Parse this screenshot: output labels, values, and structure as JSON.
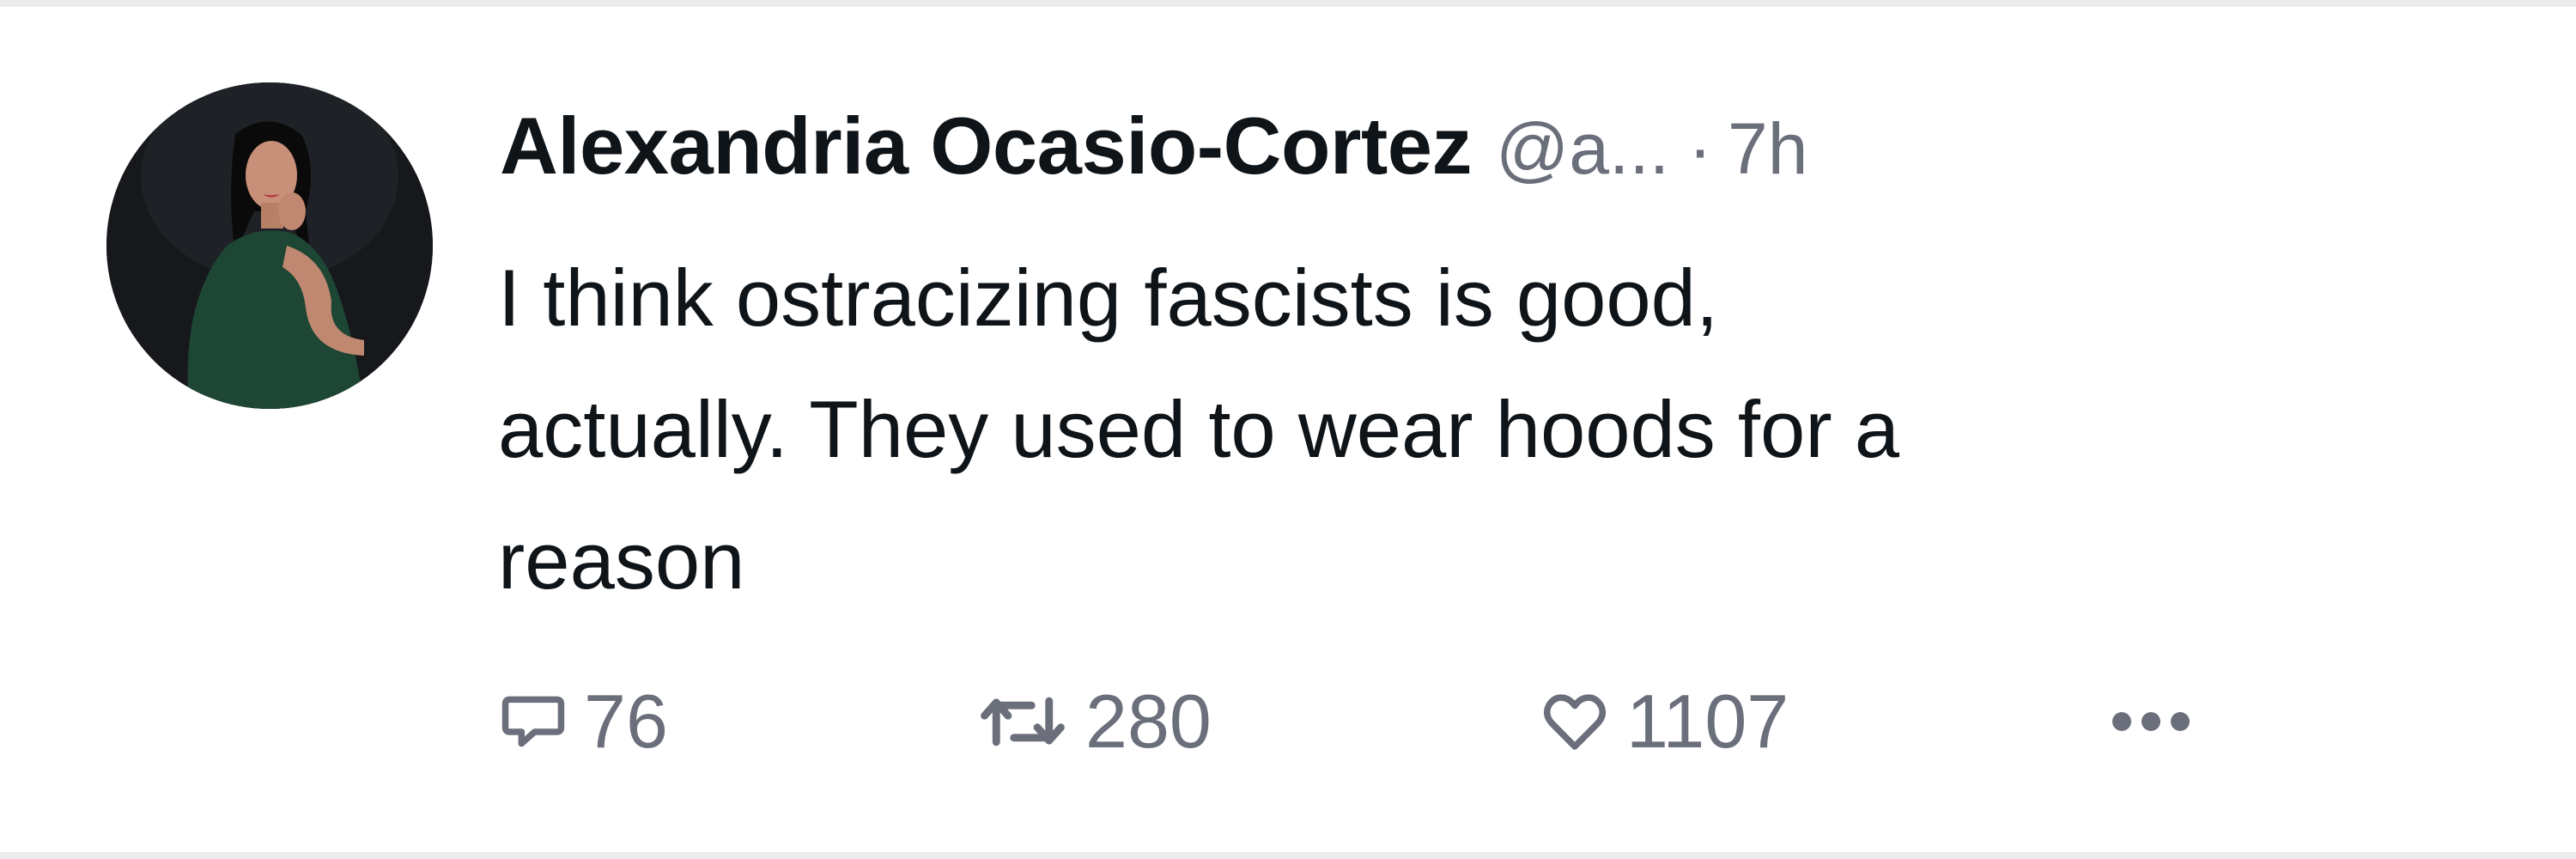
{
  "tweet": {
    "author_name": "Alexandria Ocasio-Cortez",
    "handle": "@a...",
    "separator": "·",
    "time": "7h",
    "text": "I think ostracizing fascists is good,\nactually. They used to wear hoods for a\nreason",
    "avatar_icon": "profile-photo",
    "actions": {
      "reply": {
        "icon": "speech-bubble-icon",
        "count": "76"
      },
      "retweet": {
        "icon": "retweet-arrows-icon",
        "count": "280"
      },
      "like": {
        "icon": "heart-icon",
        "count": "1107"
      },
      "more": {
        "icon": "ellipsis-icon"
      }
    }
  },
  "colors": {
    "text": "#0f1419",
    "secondary": "#6b6f7b",
    "border": "#ececef",
    "avatar_bg": "#16181c",
    "dress": "#1e4634"
  }
}
